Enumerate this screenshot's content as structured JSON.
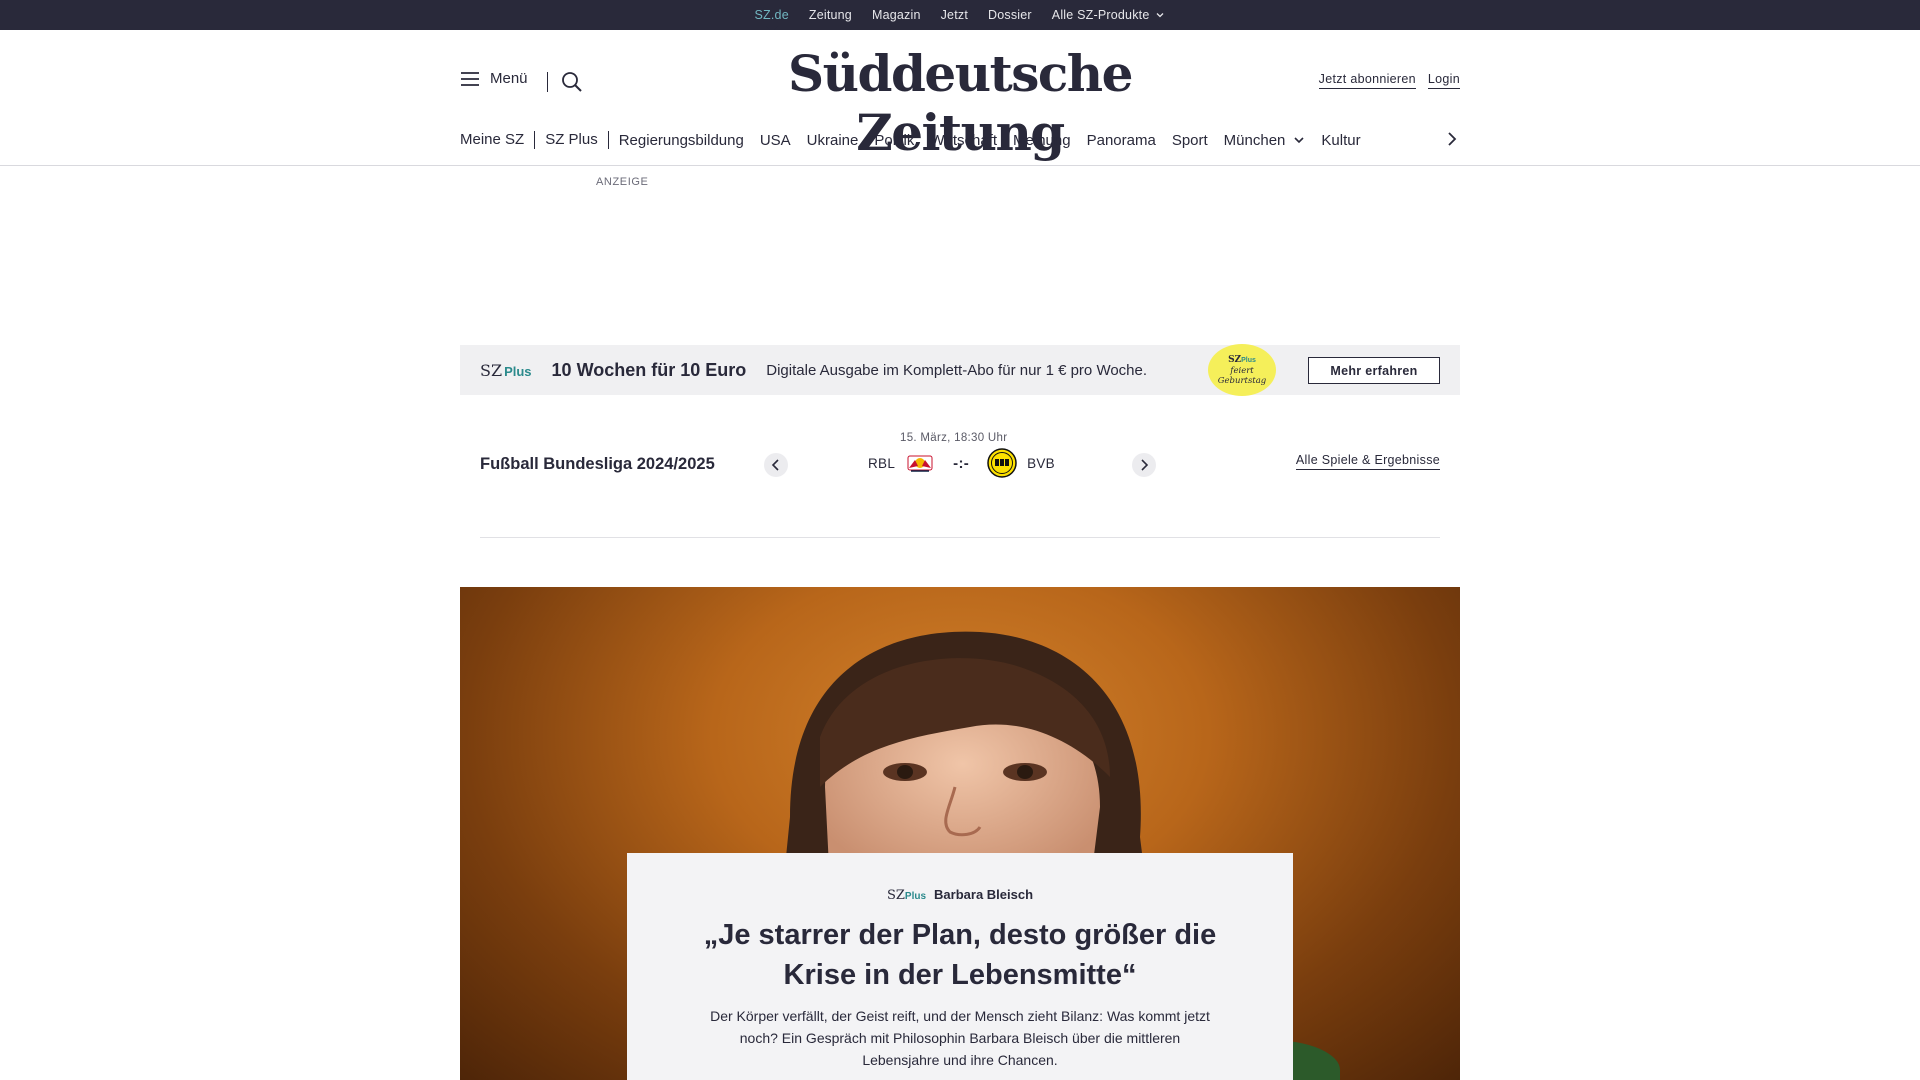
{
  "topbar": {
    "items": [
      "SZ.de",
      "Zeitung",
      "Magazin",
      "Jetzt",
      "Dossier"
    ],
    "products_label": "Alle SZ-Produkte"
  },
  "header": {
    "menu_label": "Menü",
    "logo": "Süddeutsche Zeitung",
    "subscribe_label": "Jetzt abonnieren",
    "login_label": "Login"
  },
  "nav": {
    "items": [
      "Meine SZ",
      "SZ Plus",
      "Regierungsbildung",
      "USA",
      "Ukraine",
      "Politik",
      "Wirtschaft",
      "Meinung",
      "Panorama",
      "Sport",
      "München",
      "Kultur"
    ]
  },
  "ad": {
    "label": "ANZEIGE"
  },
  "promo": {
    "logo_sz": "SZ",
    "logo_plus": "Plus",
    "title": "10 Wochen für 10 Euro",
    "text": "Digitale Ausgabe im Komplett-Abo für nur 1 € pro Woche.",
    "badge_logo_sz": "SZ",
    "badge_logo_plus": "Plus",
    "badge_line1": "feiert",
    "badge_line2": "Geburtstag",
    "button_label": "Mehr erfahren"
  },
  "bundesliga": {
    "title": "Fußball Bundesliga 2024/2025",
    "date": "15. März, 18:30 Uhr",
    "home": "RBL",
    "away": "BVB",
    "score": "-:-",
    "all_games_label": "Alle Spiele & Ergebnisse"
  },
  "hero": {
    "label_sz": "SZ",
    "label_plus": "Plus",
    "author": "Barbara Bleisch",
    "title": "„Je starrer der Plan, desto größer die Krise in der Lebensmitte“",
    "teaser": "Der Körper verfällt, der Geist reift, und der Mensch zieht Bilanz: Was kommt jetzt noch? Ein Gespräch mit Philosophin Barbara Bleisch über die mittleren Lebensjahre und ihre Chancen."
  },
  "colors": {
    "dark": "#29293a",
    "accent": "#2b8a8c",
    "badge_yellow": "#f5ef5a",
    "promo_bg": "#f0f0f2"
  }
}
